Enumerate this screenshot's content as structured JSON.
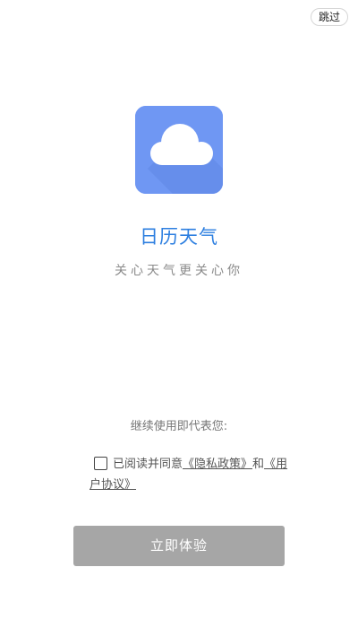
{
  "header": {
    "skip_label": "跳过"
  },
  "app": {
    "icon": "cloud-icon",
    "name": "日历天气",
    "slogan": "关心天气更关心你",
    "brand_color": "#2d7fe0",
    "icon_bg_color": "#6f97f3"
  },
  "consent": {
    "notice": "继续使用即代表您:",
    "checked": false,
    "prefix": "已阅读并同意",
    "privacy_link": "《隐私政策》",
    "conjunction": "和",
    "terms_link": "《用户协议》"
  },
  "action": {
    "start_label": "立即体验",
    "button_color": "#a6a6a6"
  }
}
